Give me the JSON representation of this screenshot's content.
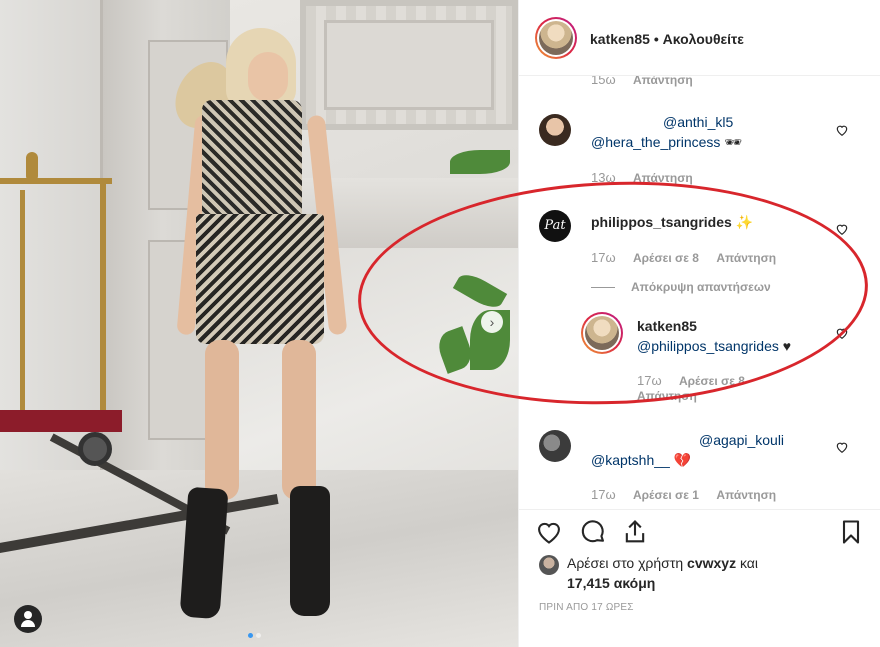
{
  "header": {
    "username": "katken85",
    "separator": "•",
    "follow_status": "Ακολουθείτε"
  },
  "comments": [
    {
      "meta": {
        "time": "15ω",
        "reply": "Απάντηση"
      }
    },
    {
      "user_partial": "",
      "text_prefix": "@anthi_kl5",
      "text": "@hera_the_princess",
      "emoji": "🕶",
      "meta": {
        "time": "13ω",
        "reply": "Απάντηση"
      }
    },
    {
      "username": "philippos_tsangrides",
      "emoji": "✨",
      "avatar_text": "Pat",
      "meta": {
        "time": "17ω",
        "likes": "Αρέσει σε 8",
        "reply": "Απάντηση"
      },
      "hide_replies": "Απόκρυψη απαντήσεων",
      "reply": {
        "username": "katken85",
        "text": "@philippos_tsangrides",
        "emoji": "♥",
        "meta": {
          "time": "17ω",
          "likes": "Αρέσει σε 8",
          "reply": "Απάντηση"
        }
      }
    },
    {
      "mention_1": "@agapi_kouli",
      "text": "@kaptshh__",
      "emoji": "💔",
      "meta": {
        "time": "17ω",
        "likes": "Αρέσει σε 1",
        "reply": "Απάντηση"
      }
    }
  ],
  "likes": {
    "prefix": "Αρέσει στο χρήστη",
    "user": "cvwxyz",
    "conjunction": "και",
    "count": "17,415 ακόμη"
  },
  "timestamp": "ΠΡΙΝ ΑΠΟ 17 ΩΡΕΣ",
  "photo": {
    "next_arrow": "›",
    "carousel_dots": 2,
    "active_dot": 1
  }
}
